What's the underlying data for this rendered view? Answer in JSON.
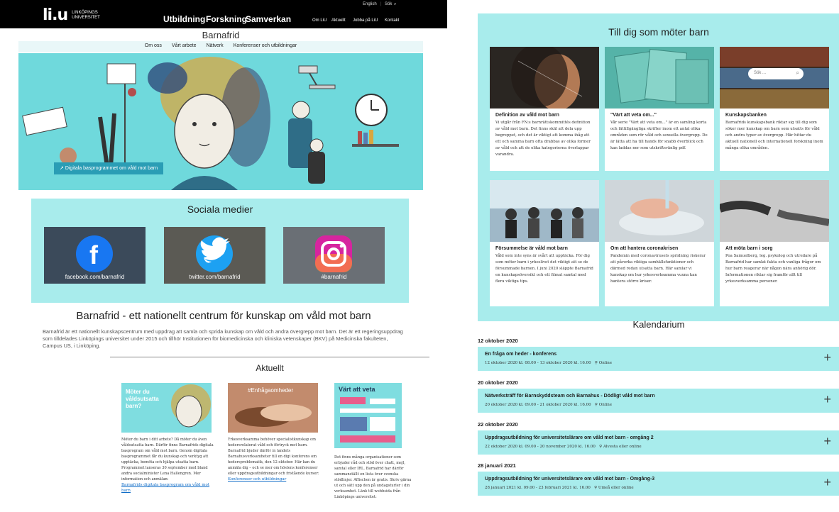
{
  "header": {
    "logo_mark": "li.u",
    "logo_text": "LINKÖPINGS UNIVERSITET",
    "util_links": [
      "English",
      "Sök"
    ],
    "main_nav": [
      "Utbildning",
      "Forskning",
      "Samverkan"
    ],
    "secondary_nav": [
      "Om LiU",
      "Aktuellt",
      "Jobba på LiU",
      "Kontakt"
    ]
  },
  "site": {
    "name": "Barnafrid",
    "subnav": [
      "Om oss",
      "Vårt arbete",
      "Nätverk",
      "Konferenser och utbildningar"
    ]
  },
  "hero": {
    "button": "Digitala basprogrammet om våld mot barn"
  },
  "social": {
    "title": "Sociala medier",
    "items": [
      {
        "label": "facebook.com/barnafrid",
        "color": "#1877f2"
      },
      {
        "label": "twitter.com/barnafrid",
        "color": "#1da1f2"
      },
      {
        "label": "#barnafrid",
        "color": "#d6249f"
      }
    ]
  },
  "center": {
    "title": "Barnafrid - ett nationellt centrum för kunskap om våld mot barn",
    "text": "Barnafrid är ett nationellt kunskapscentrum med uppdrag att samla och sprida kunskap om våld och andra övergrepp mot barn. Det är ett regeringsuppdrag som tilldelades Linköpings universitet under 2015 och tillhör Institutionen för biomedicinska och kliniska vetenskaper (BKV) på Medicinska fakulteten, Campus US, i Linköping."
  },
  "aktuellt": {
    "title": "Aktuellt",
    "items": [
      {
        "image_text": "Möter du våldsutsatta barn?",
        "text": "Möter du barn i ditt arbete? Då möter du även våldsutsatta barn. Därför finns Barnafrids digitala basprogram om våld mot barn. Genom digitala basprogrammet får du kunskap och verktyg att upptäcka, bemöta och hjälpa utsatta barn. Programmet lanseras 30 september med bland andra socialminister Lena Hallengren. Mer information och anmälan:",
        "link": "Barnafrids digitala basprogram om våld mot barn"
      },
      {
        "image_text": "#Enfrågaomheder",
        "text": "Yrkesverksamma behöver specialistkunskap om hedersrelaterat våld och förtryck mot barn. Barnafrid bjuder därför in landets Barnahusverksamheter till en digi konferens om hedersproblematik, den 12 oktober. Här kan du anmäla dig – och se mer om höstens konferenser eller uppdragsutbildningar och fristående kurser:",
        "link": "Konferenser och utbildningar"
      },
      {
        "image_text": "Värt att veta",
        "text": "Det finns många organisationer som erbjuder råd och stöd över chatt, mejl, samtal eller IRL. Barnafrid har därför sammanställt en lista över svenska stödlinjer. Affischen är gratis. Skriv gärna ut och sätt upp den på undagsturler i din verksamhet. Länk till webbsida från Linköpings universitet:",
        "link": ""
      }
    ]
  },
  "right_panel": {
    "title": "Till dig som möter barn",
    "search_placeholder": "Sök ...",
    "cards": [
      {
        "title": "Definition av våld mot barn",
        "text": "Vi utgår från FN:s barnrättskommittés definition av våld mot barn. Det finns skäl att dela upp begreppet, och det är viktigt att komma ihåg att ett och samma barn ofta drabbas av olika former av våld och att de olika kategorierna överlappar varandra."
      },
      {
        "title": "\"Värt att veta om...\"",
        "text": "Vår serie \"Värt att veta om...\" är en samling korta och lättillgängliga skrifter inom ett antal olika områden som rör våld och sexuella övergrepp. De är lätta att ha till hands för snabb överblick och kan laddas ner som utskriftsvänlig pdf."
      },
      {
        "title": "Kunskapsbanken",
        "text": "Barnafrids kunskapsbank riktar sig till dig som söker mer kunskap om barn som utsatts för våld och andra typer av övergrepp. Här hittar du aktuell nationell och internationell forskning inom många olika områden."
      },
      {
        "title": "Försummelse är våld mot barn",
        "text": "Våld som inte syns är svårt att upptäcka. För dig som möter barn i yrkeslivet det viktigt att se de försummade barnen. I juni 2020 släppte Barnafrid en kunskapsöversikt och ett filmat samtal med flera viktiga tips."
      },
      {
        "title": "Om att hantera coronakrisen",
        "text": "Pandemin med coronavirusets spridning riskerar att påverka viktiga samhällsfunktioner och därmed redan utsatta barn. Här samlar vi kunskap om hur yrkesverksamma vuxna kan hantera större kriser."
      },
      {
        "title": "Att möta barn i sorg",
        "text": "Poa Samuelberg, leg. psykolog och utredare på Barnafrid har samlat fakta och vanliga frågor om hur barn reagerar när någon nära anhörig dör. Informationen riktar sig framför allt till yrkesverksamma personer."
      }
    ]
  },
  "kalendarium": {
    "title": "Kalendarium",
    "groups": [
      {
        "date": "12 oktober 2020",
        "title": "En fråga om heder - konferens",
        "details": "12 oktober 2020 kl. 08.00 - 13 oktober 2020 kl. 16.00",
        "location": "Online"
      },
      {
        "date": "20 oktober 2020",
        "title": "Nätverksträff för Barnskyddsteam och Barnahus - Dödligt våld mot barn",
        "details": "20 oktober 2020 kl. 09.00 - 21 oktober 2020 kl. 16.00",
        "location": "Online"
      },
      {
        "date": "22 oktober 2020",
        "title": "Uppdragsutbildning för universitetslärare om våld mot barn - omgång 2",
        "details": "22 oktober 2020 kl. 09.00 - 20 november 2020 kl. 16.00",
        "location": "Alvesta eller online"
      },
      {
        "date": "28 januari 2021",
        "title": "Uppdragsutbildning för universitetslärare om våld mot barn - Omgång-3",
        "details": "28 januari 2021 kl. 09.00 - 23 februari 2021 kl. 16.00",
        "location": "Umeå eller online"
      }
    ]
  }
}
